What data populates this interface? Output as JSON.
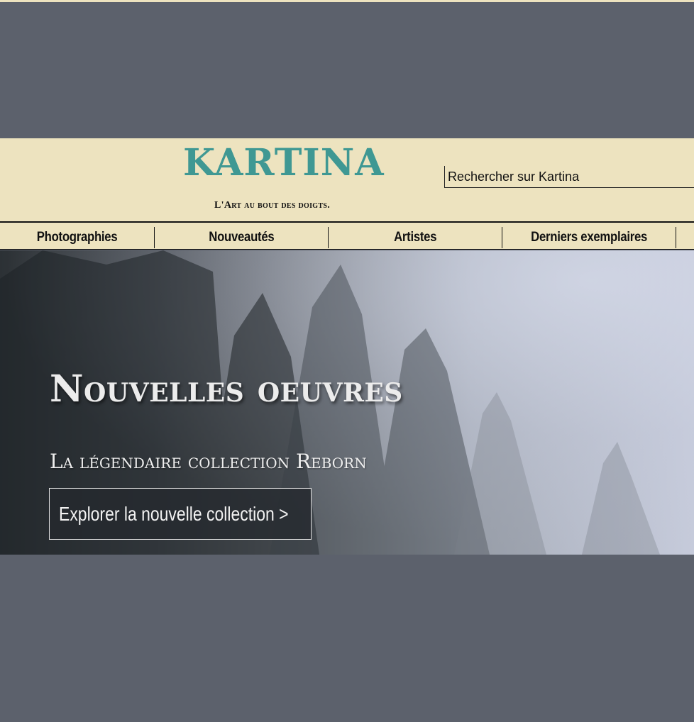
{
  "brand": {
    "name": "KARTINA",
    "tagline": "L'Art au bout des doigts.",
    "color": "#3f9893"
  },
  "search": {
    "placeholder": "Rechercher sur Kartina"
  },
  "nav": {
    "items": [
      {
        "label": "Photographies"
      },
      {
        "label": "Nouveautés"
      },
      {
        "label": "Artistes"
      },
      {
        "label": "Derniers exemplaires"
      }
    ]
  },
  "hero": {
    "title": "Nouvelles oeuvres",
    "subtitle": "La légendaire collection Reborn",
    "cta_label": "Explorer la nouvelle collection >"
  },
  "colors": {
    "page_background": "#5c616c",
    "header_background": "#ede3bf",
    "accent": "#3f9893"
  }
}
